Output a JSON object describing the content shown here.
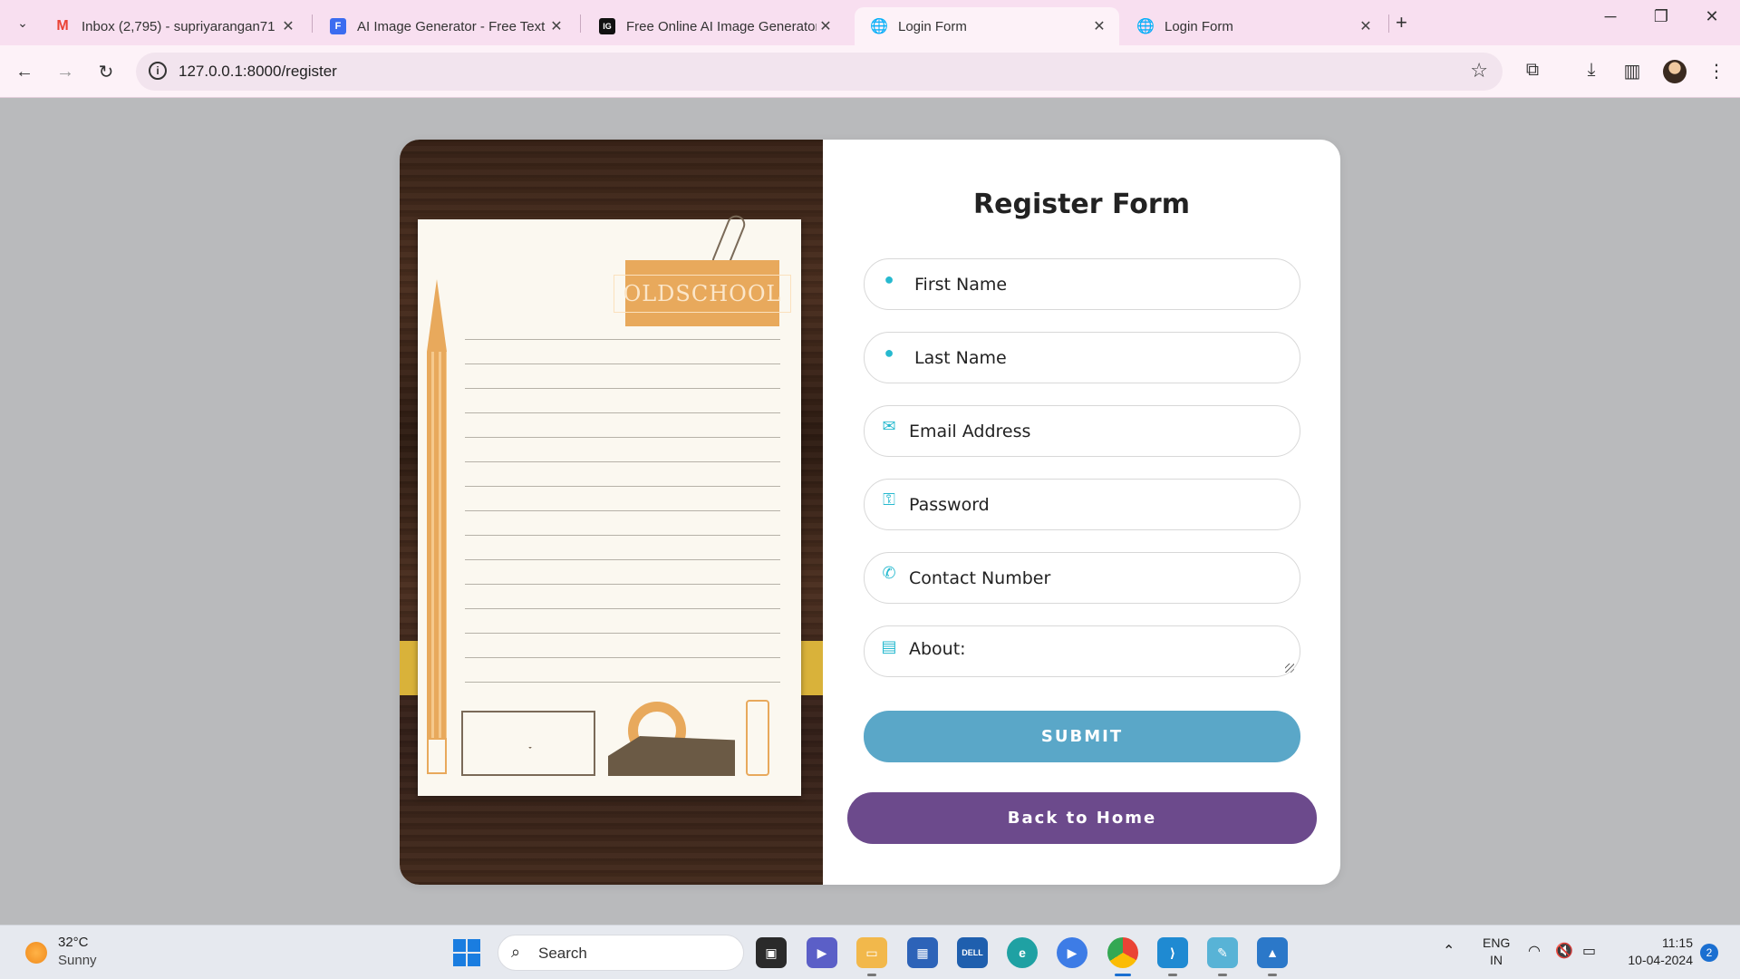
{
  "browser": {
    "tabs": [
      {
        "title": "Inbox (2,795) - supriyarangan71",
        "favicon": "gmail-icon",
        "favicon_color": "#ea4335"
      },
      {
        "title": "AI Image Generator - Free Text",
        "favicon": "f-doc-icon",
        "favicon_color": "#3b6cf0"
      },
      {
        "title": "Free Online AI Image Generator",
        "favicon": "ig-icon",
        "favicon_color": "#111111"
      },
      {
        "title": "Login Form",
        "favicon": "globe-icon",
        "favicon_color": "#555555"
      },
      {
        "title": "Login Form",
        "favicon": "globe-icon",
        "favicon_color": "#555555"
      }
    ],
    "active_tab_index": 3,
    "url": "127.0.0.1:8000/register"
  },
  "page": {
    "form_title": "Register Form",
    "illustration_text": "OLDSCHOOL",
    "fields": [
      {
        "placeholder": "First Name",
        "icon": "user-icon"
      },
      {
        "placeholder": "Last Name",
        "icon": "user-icon"
      },
      {
        "placeholder": "Email Address",
        "icon": "envelope-icon"
      },
      {
        "placeholder": "Password",
        "icon": "key-icon"
      },
      {
        "placeholder": "Contact Number",
        "icon": "phone-icon"
      },
      {
        "placeholder": "About:",
        "icon": "id-card-icon"
      }
    ],
    "submit_label": "SUBMIT",
    "back_label": "Back to Home",
    "colors": {
      "accent_icon": "#26b9cf",
      "submit_bg": "#5aa7c8",
      "back_bg": "#6c4a8c"
    }
  },
  "taskbar": {
    "weather_temp": "32°C",
    "weather_cond": "Sunny",
    "search_label": "Search",
    "lang_line1": "ENG",
    "lang_line2": "IN",
    "time": "11:15",
    "date": "10-04-2024",
    "notification_count": "2"
  }
}
